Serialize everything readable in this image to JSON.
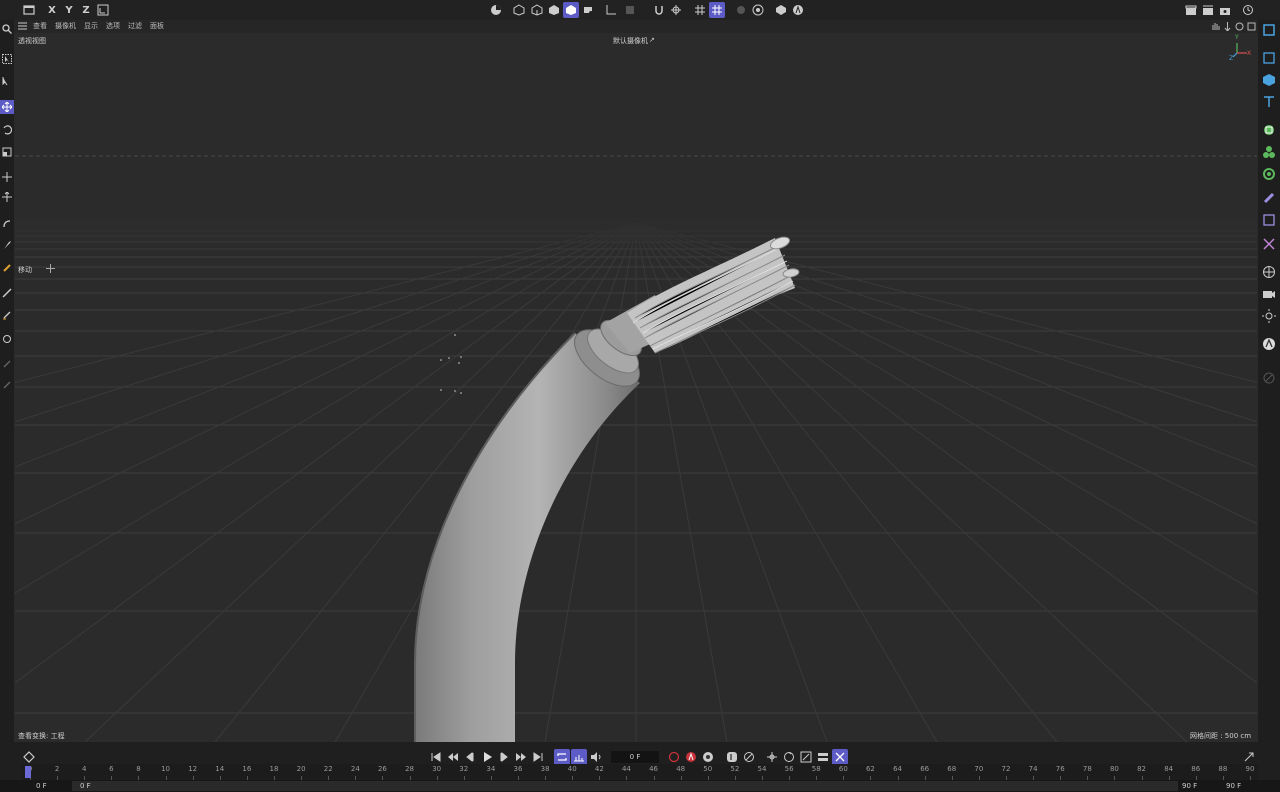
{
  "top_toolbar": {
    "axes": [
      "X",
      "Y",
      "Z"
    ]
  },
  "menubar": {
    "items": [
      "查看",
      "摄像机",
      "显示",
      "选项",
      "过滤",
      "面板"
    ]
  },
  "viewport": {
    "view_name": "透视视图",
    "camera": "默认摄像机",
    "tool_label": "移动",
    "footer_left": "查看变换: 工程",
    "grid_spacing": "网格间距 : 500 cm",
    "axis_gizmo": [
      "Y",
      "Z",
      "X"
    ]
  },
  "timeline": {
    "current_frame": "0 F",
    "ticks": [
      "0",
      "2",
      "4",
      "6",
      "8",
      "10",
      "12",
      "14",
      "16",
      "18",
      "20",
      "22",
      "24",
      "26",
      "28",
      "30",
      "32",
      "34",
      "36",
      "38",
      "40",
      "42",
      "44",
      "46",
      "48",
      "50",
      "52",
      "54",
      "56",
      "58",
      "60",
      "62",
      "64",
      "66",
      "68",
      "70",
      "72",
      "74",
      "76",
      "78",
      "80",
      "82",
      "84",
      "86",
      "88",
      "90"
    ],
    "range_start": "0 F",
    "range_start2": "0 F",
    "range_end": "90 F",
    "range_end2": "90 F"
  },
  "colors": {
    "accent": "#5d5cc7",
    "background": "#2b2b2b",
    "record": "#c8323a"
  }
}
